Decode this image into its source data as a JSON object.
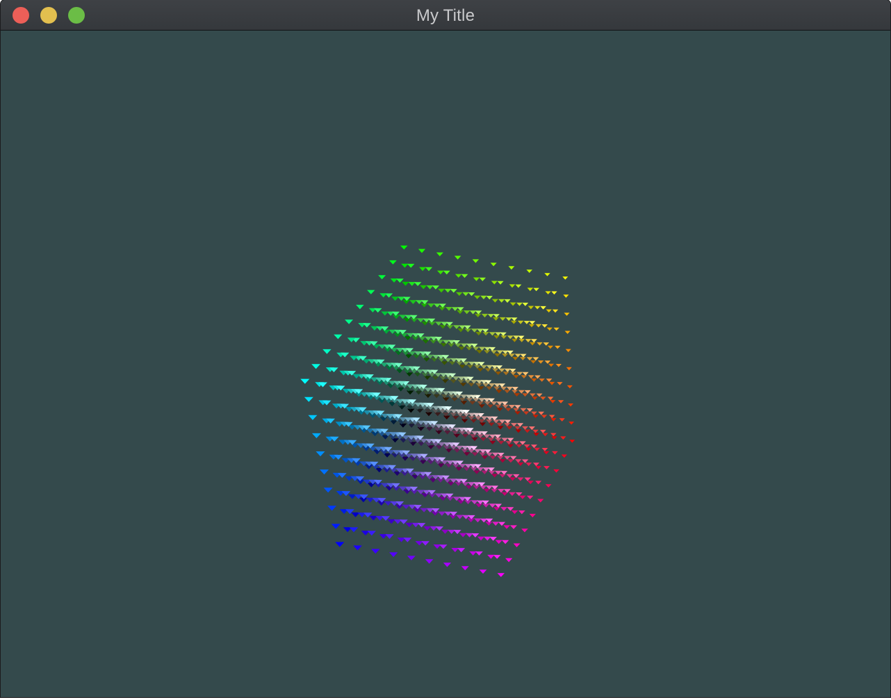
{
  "window": {
    "title": "My Title",
    "background_color": "#344a4c",
    "titlebar_buttons": [
      {
        "name": "close",
        "color": "#ec5f58"
      },
      {
        "name": "minimize",
        "color": "#e2bf4f"
      },
      {
        "name": "zoom",
        "color": "#6bbd46"
      }
    ]
  },
  "scene": {
    "description_type": "3D colored point cube",
    "grid_divisions": 10,
    "marker_shape": "triangle",
    "corner_colors": {
      "cyan": "#00e5ff",
      "green": "#00e000",
      "yellow": "#f0e000",
      "blue": "#0000ff",
      "white": "#ffffff",
      "red": "#ff0000",
      "magenta": "#ff00ff",
      "black": "#000000"
    }
  }
}
